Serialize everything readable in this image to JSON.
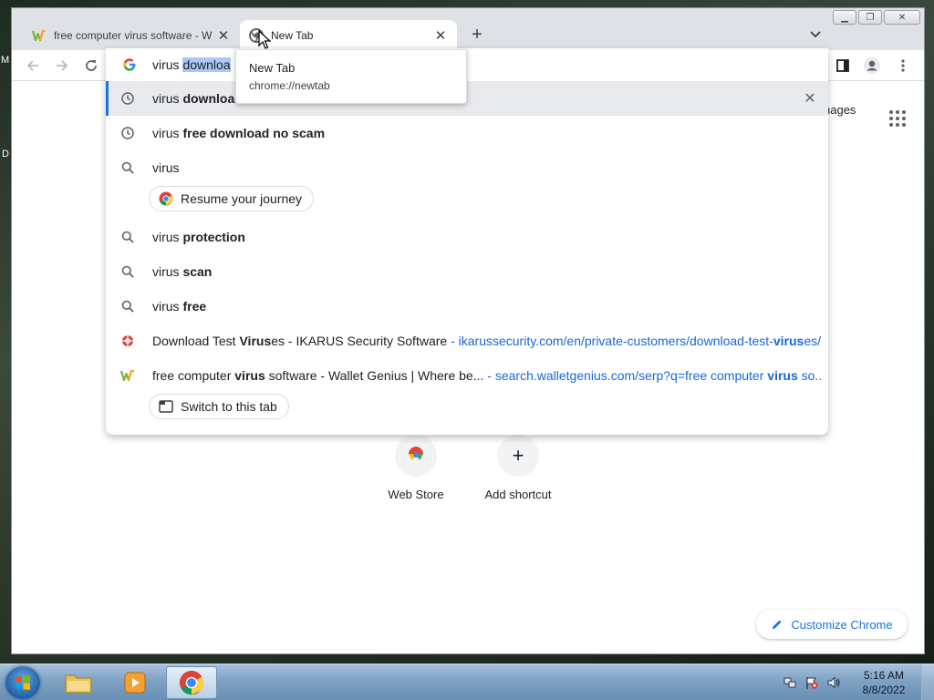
{
  "desktop": {
    "peek_top": "M",
    "peek_mid": "D"
  },
  "tabs": [
    {
      "title": "free computer virus software - W",
      "active": false
    },
    {
      "title": "New Tab",
      "active": true
    }
  ],
  "hovercard": {
    "title": "New Tab",
    "url": "chrome://newtab"
  },
  "omnibox": {
    "typed": "virus ",
    "selected_completion": "downloa",
    "suggestions": {
      "s0": {
        "plain": "virus ",
        "bold": "downloa",
        "icon": "history-icon"
      },
      "s1": {
        "plain": "virus ",
        "bold": "free download no scam",
        "icon": "history-icon"
      },
      "s2": {
        "plain": "virus",
        "bold": "",
        "icon": "search-icon"
      },
      "s3": {
        "plain": "virus ",
        "bold": "protection",
        "icon": "search-icon"
      },
      "s4": {
        "plain": "virus ",
        "bold": "scan",
        "icon": "search-icon"
      },
      "s5": {
        "plain": "virus ",
        "bold": "free",
        "icon": "search-icon"
      },
      "s6": {
        "title_pre": "Download Test ",
        "title_bold": "Virus",
        "title_post": "es - IKARUS Security Software",
        "sep": " - ",
        "url_pre": "ikarussecurity.com/en/private-customers/download-test-",
        "url_bold": "virus",
        "url_post": "es/",
        "icon": "ikarus-favicon-icon"
      },
      "s7": {
        "title_pre": "free computer ",
        "title_bold": "virus",
        "title_post": " software - Wallet Genius | Where be...",
        "sep": " - ",
        "url_pre": "search.walletgenius.com/serp?q=free computer ",
        "url_bold": "virus",
        "url_post": " so...",
        "icon": "walletgenius-favicon-icon"
      }
    },
    "chips": {
      "resume": "Resume your journey",
      "switch_tab": "Switch to this tab"
    }
  },
  "ntp": {
    "images_link": "nages",
    "shortcut_webstore": "Web Store",
    "shortcut_add": "Add shortcut",
    "customize": "Customize Chrome"
  },
  "taskbar": {
    "time": "5:16 AM",
    "date": "8/8/2022"
  },
  "colors": {
    "accent": "#1a73e8",
    "url_blue": "#1967d2",
    "selection": "#a9c8f5",
    "tabstrip": "#dee1e6"
  }
}
